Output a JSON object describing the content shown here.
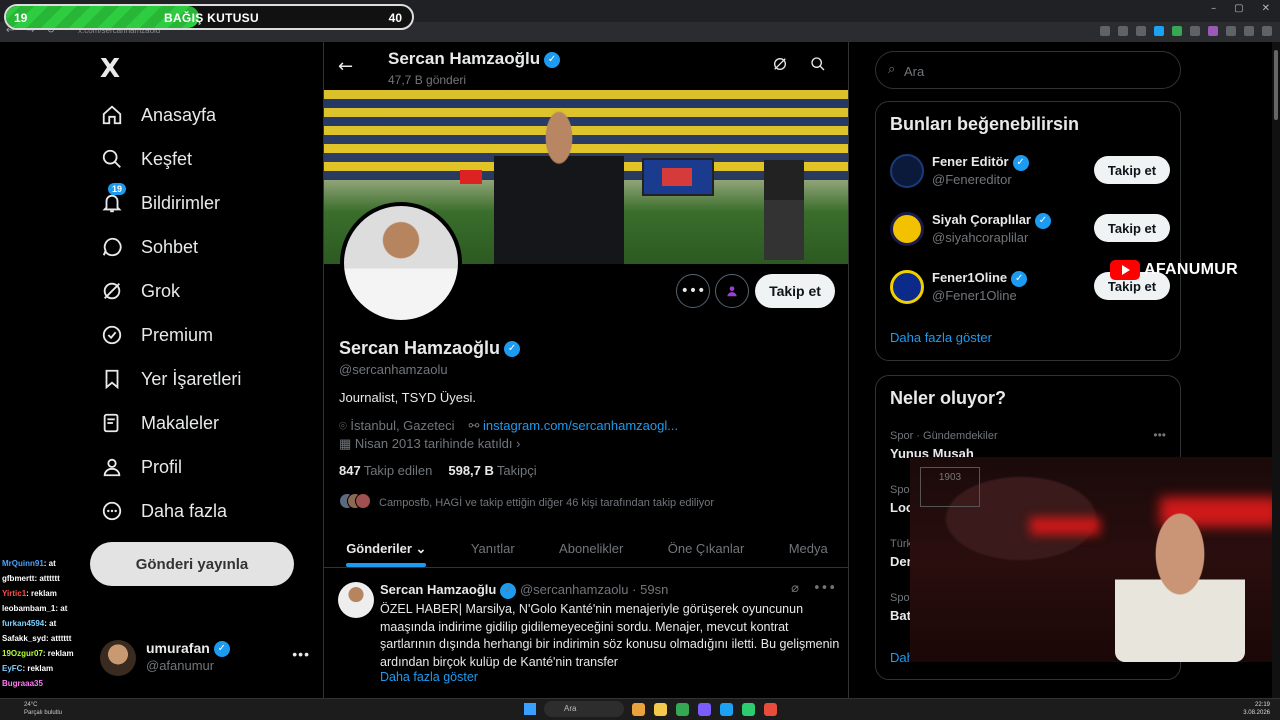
{
  "overlay": {
    "donation_left": "19",
    "donation_title": "BAĞIŞ KUTUSU",
    "donation_right": "40",
    "donation_progress": 0.475,
    "brand": "AFANUMUR"
  },
  "browser": {
    "url": "x.com/sercanhamzaolu",
    "window_controls": [
      "–",
      "▢",
      "✕"
    ]
  },
  "sidebar": {
    "logo": "X",
    "items": [
      {
        "label": "Anasayfa",
        "icon": "home-icon"
      },
      {
        "label": "Keşfet",
        "icon": "search-icon"
      },
      {
        "label": "Bildirimler",
        "icon": "bell-icon",
        "badge": "19"
      },
      {
        "label": "Sohbet",
        "icon": "chat-icon"
      },
      {
        "label": "Grok",
        "icon": "grok-icon"
      },
      {
        "label": "Premium",
        "icon": "verified-badge-icon"
      },
      {
        "label": "Yer İşaretleri",
        "icon": "bookmark-icon"
      },
      {
        "label": "Makaleler",
        "icon": "article-icon"
      },
      {
        "label": "Profil",
        "icon": "person-icon"
      },
      {
        "label": "Daha fazla",
        "icon": "more-circle-icon"
      }
    ],
    "post_button": "Gönderi yayınla",
    "account": {
      "name": "umurafan",
      "handle": "@afanumur",
      "more": "•••"
    }
  },
  "chat": [
    {
      "user": "MrQuinn91",
      "msg": ": at"
    },
    {
      "user": "gfbmertt",
      "msg": ": atttttt"
    },
    {
      "user": "Yirtic1",
      "msg": ": reklam"
    },
    {
      "user": "leobambam_1",
      "msg": ": at"
    },
    {
      "user": "furkan4594",
      "msg": ": at"
    },
    {
      "user": "Safakk_syd",
      "msg": ": atttttt"
    },
    {
      "user": "19Ozgur07",
      "msg": ": reklam"
    },
    {
      "user": "EyFC",
      "msg": ": reklam"
    },
    {
      "user": "Bugraaa35",
      "msg": ""
    }
  ],
  "profile": {
    "header_name": "Sercan Hamzaoğlu",
    "header_posts": "47,7 B gönderi",
    "name": "Sercan Hamzaoğlu",
    "handle": "@sercanhamzaolu",
    "bio": "Journalist, TSYD Üyesi.",
    "location": "İstanbul, Gazeteci",
    "link": "instagram.com/sercanhamzaogl...",
    "joined": "Nisan 2013 tarihinde katıldı",
    "following_count": "847",
    "following_label": "Takip edilen",
    "followers_count": "598,7 B",
    "followers_label": "Takipçi",
    "mutual": "Camposfb, HAGİ ve takip ettiğin diğer 46 kişi tarafından takip ediliyor",
    "follow_button": "Takip et"
  },
  "tabs": [
    "Gönderiler",
    "Yanıtlar",
    "Abonelikler",
    "Öne Çıkanlar",
    "Medya"
  ],
  "tweet": {
    "name": "Sercan Hamzaoğlu",
    "handle": "@sercanhamzaolu",
    "time": "· 59sn",
    "text": "ÖZEL HABER| Marsilya, N'Golo Kanté'nin menajeriyle görüşerek oyuncunun maaşında indirime gidilip gidilemeyeceğini sordu. Menajer, mevcut kontrat şartlarının dışında herhangi bir indirimin söz konusu olmadığını iletti. Bu gelişmenin ardından birçok kulüp de Kanté'nin transfer",
    "show_more": "Daha fazla göster"
  },
  "right": {
    "search_placeholder": "Ara",
    "suggest_title": "Bunları beğenebilirsin",
    "suggestions": [
      {
        "name": "Fener Editör",
        "handle": "@Fenereditor",
        "button": "Takip et"
      },
      {
        "name": "Siyah Çoraplılar",
        "handle": "@siyahcoraplilar",
        "button": "Takip et"
      },
      {
        "name": "Fener1Oline",
        "handle": "@Fener1Oline",
        "button": "Takip et"
      }
    ],
    "show_more": "Daha fazla göster",
    "trends_title": "Neler oluyor?",
    "trends": [
      {
        "category": "Spor · Gündemdekiler",
        "name": "Yunus Musah"
      },
      {
        "category": "Spor",
        "name": "Lool"
      },
      {
        "category": "Türki",
        "name": "Deri"
      },
      {
        "category": "Spor",
        "name": "Batı"
      }
    ],
    "trends_more": "Dah"
  },
  "taskbar": {
    "weather": "24°C",
    "weather_sub": "Parçalı bulutlu",
    "search": "Ara",
    "time": "22:19",
    "date": "3.08.2026"
  },
  "webcam": {
    "jersey": "1903"
  }
}
